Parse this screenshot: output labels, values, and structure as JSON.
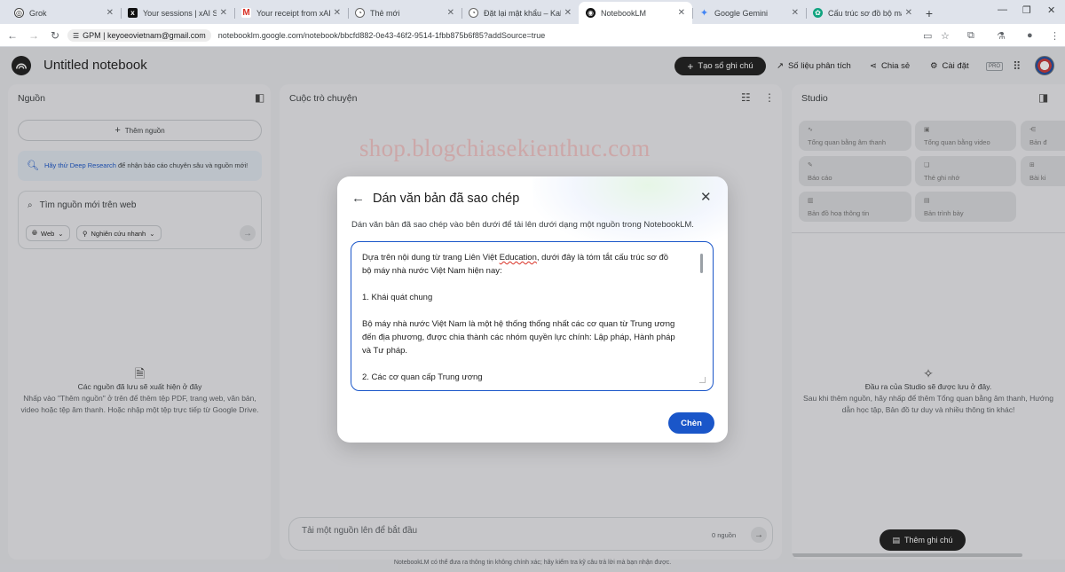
{
  "browser": {
    "tabs": [
      {
        "title": "Grok",
        "icon": "grok-icon",
        "active": false
      },
      {
        "title": "Your sessions | xAI Single",
        "icon": "xai-icon",
        "active": false
      },
      {
        "title": "Your receipt from xAI, LLC",
        "icon": "gmail-icon",
        "active": false
      },
      {
        "title": "Thẻ mới",
        "icon": "new-tab-icon",
        "active": false
      },
      {
        "title": "Đặt lại mật khẩu – Kahoot",
        "icon": "kahoot-icon",
        "active": false
      },
      {
        "title": "NotebookLM",
        "icon": "notebooklm-icon",
        "active": true
      },
      {
        "title": "Google Gemini",
        "icon": "gemini-icon",
        "active": false
      },
      {
        "title": "Cấu trúc sơ đồ bộ máy nh",
        "icon": "chatgpt-icon",
        "active": false
      }
    ],
    "profile_badge": "GPM | keyoeovietnam@gmail.com",
    "url": "notebooklm.google.com/notebook/bbcfd882-0e43-46f2-9514-1fbb875b6f85?addSource=true"
  },
  "header": {
    "title": "Untitled notebook",
    "create_button": "Tạo sổ ghi chú",
    "analytics": "Số liệu phân tích",
    "share": "Chia sẻ",
    "settings": "Cài đặt",
    "pro_badge": "PRO"
  },
  "sources": {
    "title": "Nguồn",
    "add_button": "Thêm nguồn",
    "deep_research_link": "Hãy thử Deep Research",
    "deep_research_text": "để nhận báo cáo chuyên sâu và nguồn mới!",
    "search_placeholder": "Tìm nguồn mới trên web",
    "chip_web": "Web",
    "chip_research": "Nghiên cứu nhanh",
    "empty_title": "Các nguồn đã lưu sẽ xuất hiện ở đây",
    "empty_desc": "Nhấp vào \"Thêm nguồn\" ở trên để thêm tệp PDF, trang web, văn bản, video hoặc tệp âm thanh. Hoặc nhập một tệp trực tiếp từ Google Drive."
  },
  "chat": {
    "title": "Cuộc trò chuyện",
    "watermark": "shop.blogchiasekienthuc.com",
    "input_placeholder": "Tải một nguồn lên để bắt đầu",
    "source_count": "0 nguồn"
  },
  "studio": {
    "title": "Studio",
    "tiles": [
      {
        "label": "Tổng quan bằng âm thanh"
      },
      {
        "label": "Tổng quan bằng video"
      },
      {
        "label": "Bản đ"
      },
      {
        "label": "Báo cáo"
      },
      {
        "label": "Thẻ ghi nhớ"
      },
      {
        "label": "Bài ki"
      },
      {
        "label": "Bản đồ hoạ thông tin"
      },
      {
        "label": "Bản trình bày"
      }
    ],
    "empty_title": "Đầu ra của Studio sẽ được lưu ở đây.",
    "empty_desc": "Sau khi thêm nguồn, hãy nhấp để thêm Tổng quan bằng âm thanh, Hướng dẫn học tập, Bản đồ tư duy và nhiều thông tin khác!",
    "add_note_button": "Thêm ghi chú"
  },
  "footer": "NotebookLM có thể đưa ra thông tin không chính xác; hãy kiểm tra kỹ câu trả lời mà bạn nhận được.",
  "modal": {
    "title": "Dán văn bản đã sao chép",
    "description": "Dán văn bản đã sao chép vào bên dưới để tải lên dưới dạng một nguồn trong NotebookLM.",
    "text_lines": {
      "l1a": "Dựa trên nội dung từ trang Liên Việt ",
      "l1b": "Education",
      "l1c": ", dưới đây là tóm tắt cấu trúc sơ đồ",
      "l2": "bộ máy nhà nước Việt Nam hiện nay:",
      "l3": "1. Khái quát chung",
      "l4": "Bộ máy nhà nước Việt Nam là một hệ thống thống nhất các cơ quan từ Trung ương",
      "l5": "đến địa phương, được chia thành các nhóm quyền lực chính: Lập pháp, Hành pháp",
      "l6": "và Tư pháp.",
      "l7": "2. Các cơ quan cấp Trung ương"
    },
    "insert_button": "Chèn"
  },
  "colors": {
    "accent_blue": "#1a56c9",
    "dark_button": "#1f1f1f",
    "watermark": "#f2c5c6"
  }
}
